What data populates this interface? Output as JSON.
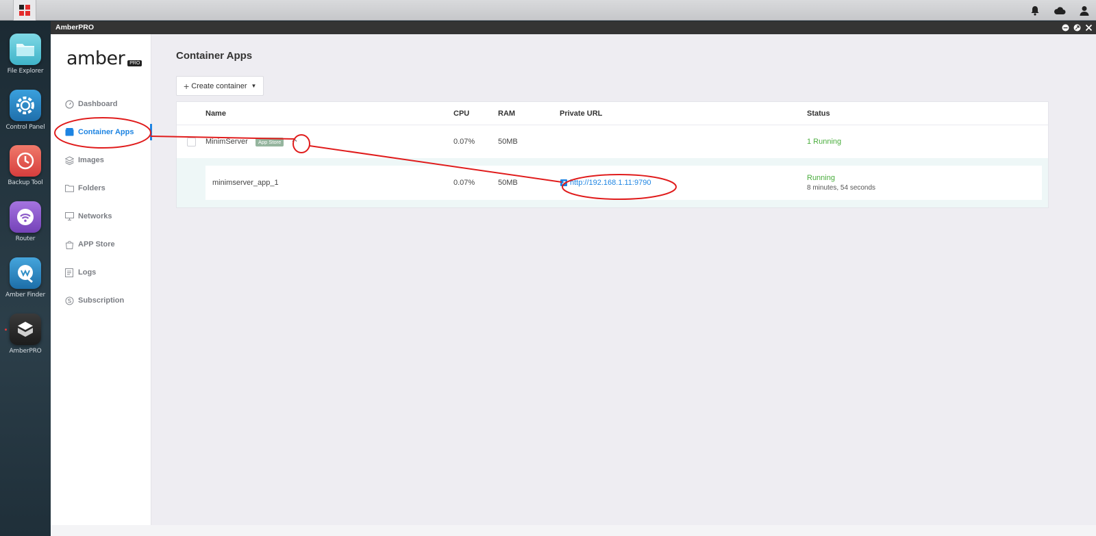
{
  "window": {
    "title": "AmberPRO"
  },
  "dock": {
    "items": [
      {
        "label": "File Explorer",
        "icon": "folder-icon",
        "color": "#5cc6d8"
      },
      {
        "label": "Control Panel",
        "icon": "gear-icon",
        "color": "#2a8ac4"
      },
      {
        "label": "Backup Tool",
        "icon": "clock-icon",
        "color": "#e2544d"
      },
      {
        "label": "Router",
        "icon": "wifi-icon",
        "color": "#8b58c8"
      },
      {
        "label": "Amber Finder",
        "icon": "finder-icon",
        "color": "#2f8ec6"
      },
      {
        "label": "AmberPRO",
        "icon": "box-icon",
        "color": "#2b2b2b"
      }
    ]
  },
  "sidebar": {
    "logo": "amber",
    "logo_badge": "PRO",
    "items": [
      {
        "label": "Dashboard",
        "icon": "gauge-icon"
      },
      {
        "label": "Container Apps",
        "icon": "container-icon",
        "active": true
      },
      {
        "label": "Images",
        "icon": "layers-icon"
      },
      {
        "label": "Folders",
        "icon": "folder-icon"
      },
      {
        "label": "Networks",
        "icon": "monitor-icon"
      },
      {
        "label": "APP Store",
        "icon": "bag-icon"
      },
      {
        "label": "Logs",
        "icon": "list-icon"
      },
      {
        "label": "Subscription",
        "icon": "coin-icon"
      }
    ]
  },
  "main": {
    "title": "Container Apps",
    "create_button": "Create container",
    "columns": {
      "name": "Name",
      "cpu": "CPU",
      "ram": "RAM",
      "url": "Private URL",
      "status": "Status"
    },
    "container": {
      "name": "MinimServer",
      "badge": "App Store",
      "cpu": "0.07%",
      "ram": "50MB",
      "status": "1 Running"
    },
    "sub_container": {
      "name": "minimserver_app_1",
      "cpu": "0.07%",
      "ram": "50MB",
      "url": "http://192.168.1.11:9790",
      "status": "Running",
      "uptime": "8 minutes, 54 seconds"
    }
  },
  "colors": {
    "accent": "#1d84e2",
    "running": "#49ad3c",
    "annotation": "#e01b1b"
  }
}
